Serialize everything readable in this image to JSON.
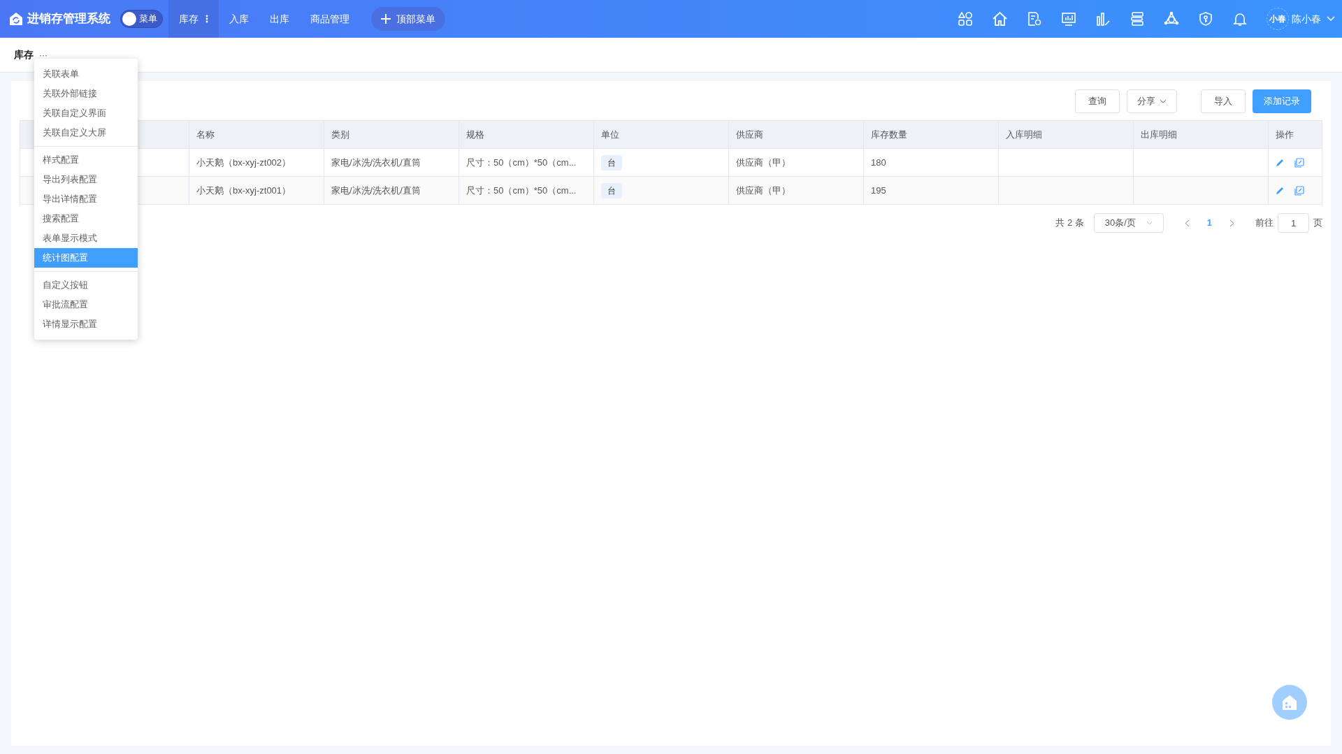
{
  "header": {
    "title": "进销存管理系统",
    "menu_toggle": {
      "label": "菜单",
      "on": false
    },
    "nav": [
      {
        "label": "库存",
        "selected": true
      },
      {
        "label": "入库",
        "selected": false
      },
      {
        "label": "出库",
        "selected": false
      },
      {
        "label": "商品管理",
        "selected": false
      }
    ],
    "add_menu": "顶部菜单",
    "user": {
      "avatar": "小春",
      "name": "陈小春"
    }
  },
  "breadcrumb": {
    "title": "库存",
    "more": "···"
  },
  "dropdown": {
    "groups": [
      [
        {
          "label": "关联表单",
          "selected": false
        },
        {
          "label": "关联外部链接",
          "selected": false
        },
        {
          "label": "关联自定义界面",
          "selected": false
        },
        {
          "label": "关联自定义大屏",
          "selected": false
        }
      ],
      [
        {
          "label": "样式配置",
          "selected": false
        },
        {
          "label": "导出列表配置",
          "selected": false
        },
        {
          "label": "导出详情配置",
          "selected": false
        },
        {
          "label": "搜索配置",
          "selected": false
        },
        {
          "label": "表单显示模式",
          "selected": false
        },
        {
          "label": "统计图配置",
          "selected": true
        }
      ],
      [
        {
          "label": "自定义按钮",
          "selected": false
        },
        {
          "label": "审批流配置",
          "selected": false
        },
        {
          "label": "详情显示配置",
          "selected": false
        }
      ]
    ]
  },
  "toolbar": [
    {
      "label": "查询",
      "kind": "plain"
    },
    {
      "label": "分享",
      "kind": "dropdown"
    },
    {
      "label": "导入",
      "kind": "plain"
    },
    {
      "label": "添加记录",
      "kind": "primary"
    }
  ],
  "table": {
    "columns": [
      "名称",
      "类别",
      "规格",
      "单位",
      "供应商",
      "库存数量",
      "入库明细",
      "出库明细",
      "操作"
    ],
    "rows": [
      {
        "name": "小天鹅（bx-xyj-zt002）",
        "category": "家电/冰洗/洗衣机/直筒",
        "spec": "尺寸：50（cm）*50（cm...",
        "unit": "台",
        "supplier": "供应商（甲）",
        "stock": "180"
      },
      {
        "name": "小天鹅（bx-xyj-zt001）",
        "category": "家电/冰洗/洗衣机/直筒",
        "spec": "尺寸：50（cm）*50（cm...",
        "unit": "台",
        "supplier": "供应商（甲）",
        "stock": "195"
      }
    ]
  },
  "pagination": {
    "total": "共 2 条",
    "page_size": "30条/页",
    "pages": [
      {
        "label": "1",
        "selected": true
      }
    ],
    "goto_label": "前往",
    "goto_value": "1",
    "goto_suffix": "页"
  }
}
